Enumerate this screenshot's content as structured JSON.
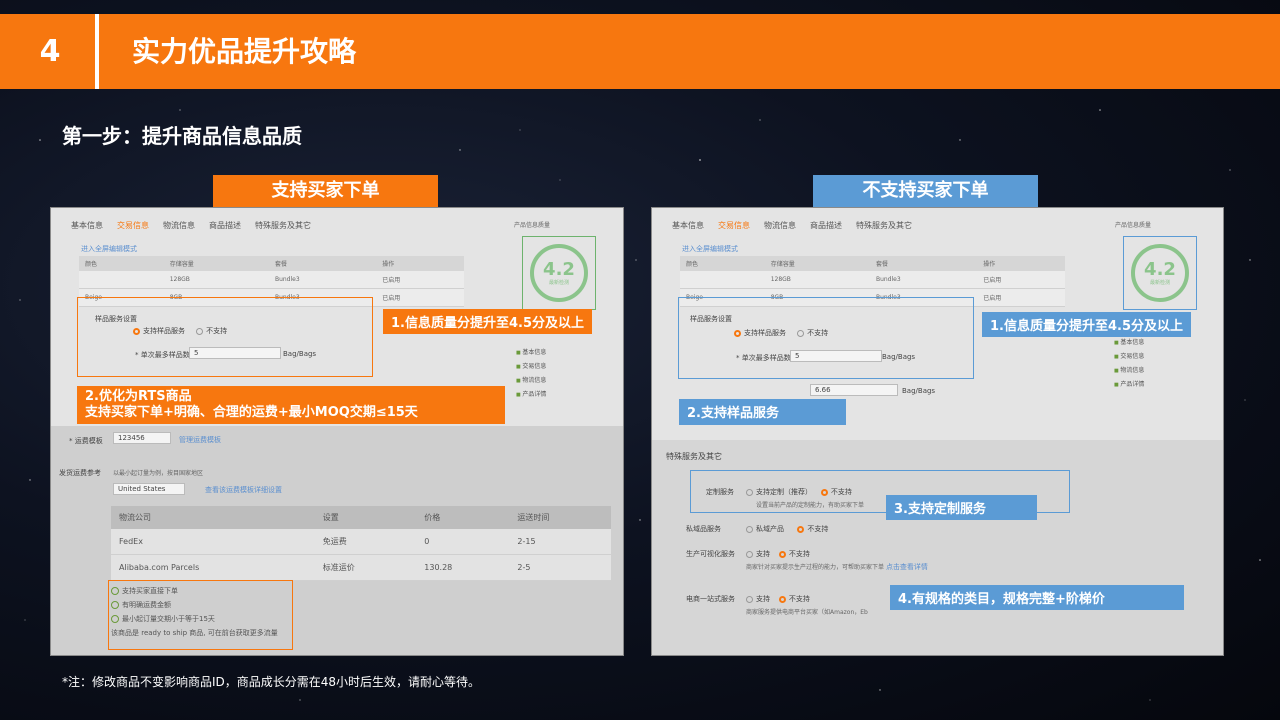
{
  "slide": {
    "number": "4",
    "title": "实力优品提升攻略",
    "step_title": "第一步：提升商品信息品质",
    "footnote": "*注：修改商品不变影响商品ID，商品成长分需在48小时后生效，请耐心等待。"
  },
  "left": {
    "tag": "支持买家下单",
    "tabs": [
      "基本信息",
      "交易信息",
      "物流信息",
      "商品描述",
      "特殊服务及其它"
    ],
    "active_tab_index": 1,
    "edit_link": "进入全屏编辑模式",
    "table_headers": [
      "颜色",
      "存储容量",
      "套餐",
      "操作"
    ],
    "table_rows": [
      [
        "",
        "128GB",
        "Bundle3",
        "已启用"
      ],
      [
        "Beige",
        "8GB",
        "Bundle3",
        "已启用"
      ]
    ],
    "score_label": "产品信息质量",
    "score": "4.2",
    "score_sub": "最新检测",
    "side_items": [
      "基本信息",
      "交易信息",
      "物流信息",
      "产品详情"
    ],
    "sample_label": "样品服务设置",
    "radio_support": "支持样品服务",
    "radio_unsupport": "不支持",
    "moq_label": "* 单次最多样品数量",
    "moq_value": "5",
    "unit": "Bag/Bags",
    "callout_1": "1.信息质量分提升至4.5分及以上",
    "callout_2_line1": "2.优化为RTS商品",
    "callout_2_line2": "支持买家下单+明确、合理的运费+最小MOQ交期≤15天",
    "shipping_template_label": "* 运费模板",
    "shipping_template_value": "123456",
    "shipping_template_link": "管理运费模板",
    "shipping_ref_label": "发货运费参考",
    "shipping_ref_hint": "以最小起订量为例，按目国家地区",
    "country_value": "United States",
    "country_link": "查看该运费模板详细设置",
    "ship_headers": [
      "物流公司",
      "设置",
      "价格",
      "运送时间"
    ],
    "ship_rows": [
      [
        "FedEx",
        "免运费",
        "0",
        "2-15"
      ],
      [
        "Alibaba.com Parcels",
        "标准运价",
        "130.28",
        "2-5"
      ]
    ],
    "checks": [
      "支持买家直接下单",
      "有明确运费金额",
      "最小起订量交期小于等于15天"
    ],
    "rts_note": "该商品是 ready to ship 商品, 可在前台获取更多流量"
  },
  "right": {
    "tag": "不支持买家下单",
    "tabs": [
      "基本信息",
      "交易信息",
      "物流信息",
      "商品描述",
      "特殊服务及其它"
    ],
    "active_tab_index": 1,
    "edit_link": "进入全屏编辑模式",
    "table_headers": [
      "颜色",
      "存储容量",
      "套餐",
      "操作"
    ],
    "table_rows": [
      [
        "",
        "128GB",
        "Bundle3",
        "已启用"
      ],
      [
        "Beige",
        "8GB",
        "Bundle3",
        "已启用"
      ]
    ],
    "score_label": "产品信息质量",
    "score": "4.2",
    "score_sub": "最新检测",
    "side_items": [
      "基本信息",
      "交易信息",
      "物流信息",
      "产品详情"
    ],
    "sample_label": "样品服务设置",
    "radio_support": "支持样品服务",
    "radio_unsupport": "不支持",
    "moq_label": "* 单次最多样品数量",
    "moq_value": "5",
    "unit": "Bag/Bags",
    "price_value": "6.66",
    "callout_1": "1.信息质量分提升至4.5分及以上",
    "callout_2": "2.支持样品服务",
    "special_title": "特殊服务及其它",
    "custom_label": "定制服务",
    "custom_yes": "支持定制（推荐）",
    "custom_no": "不支持",
    "custom_hint": "设置当前产品的定制能力，有助买家下单",
    "private_label": "私域品服务",
    "private_yes": "私域产品",
    "private_no": "不支持",
    "visual_label": "生产可视化服务",
    "visual_yes": "支持",
    "visual_no": "不支持",
    "visual_hint": "商家针对买家提示生产过程的能力，可帮助买家下单",
    "visual_link": "点击查看详情",
    "ecom_label": "电商一站式服务",
    "ecom_yes": "支持",
    "ecom_no": "不支持",
    "ecom_hint": "商家服务提供电商平台买家（如Amazon，Eb",
    "callout_3": "3.支持定制服务",
    "callout_4": "4.有规格的类目，规格完整+阶梯价"
  },
  "colors": {
    "orange": "#f7770f",
    "blue": "#5b9bd5",
    "score_green": "#8bc48b"
  }
}
